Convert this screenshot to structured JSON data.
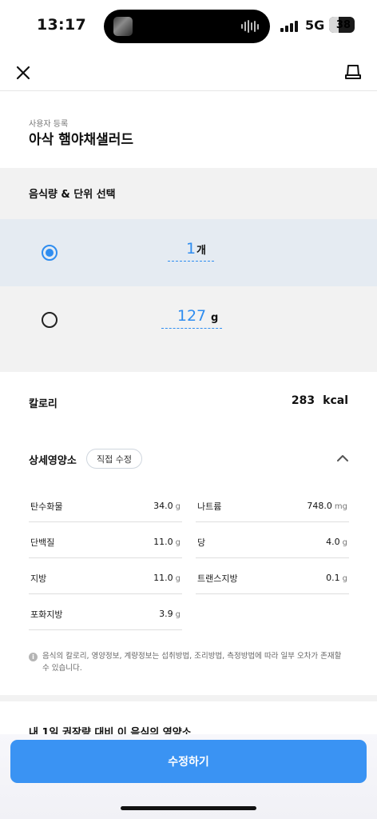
{
  "status": {
    "time": "13:17",
    "network": "5G",
    "battery": "38",
    "battery_level_percent": 38
  },
  "header": {
    "close_icon": "close-icon",
    "save_icon": "save-icon"
  },
  "food": {
    "source": "사용자 등록",
    "name": "아삭 햄야채샐러드"
  },
  "unit_section": {
    "title": "음식량 & 단위 선택",
    "options": [
      {
        "amount": "1",
        "unit": "개",
        "selected": true
      },
      {
        "amount": "127",
        "unit": "g",
        "selected": false
      }
    ]
  },
  "calorie": {
    "label": "칼로리",
    "value": "283",
    "unit": "kcal"
  },
  "detail": {
    "title": "상세영양소",
    "edit_label": "직접 수정",
    "nutrients": [
      {
        "name": "탄수화물",
        "value": "34.0",
        "unit": "g"
      },
      {
        "name": "나트륨",
        "value": "748.0",
        "unit": "mg"
      },
      {
        "name": "단백질",
        "value": "11.0",
        "unit": "g"
      },
      {
        "name": "당",
        "value": "4.0",
        "unit": "g"
      },
      {
        "name": "지방",
        "value": "11.0",
        "unit": "g"
      },
      {
        "name": "트랜스지방",
        "value": "0.1",
        "unit": "g"
      },
      {
        "name": "포화지방",
        "value": "3.9",
        "unit": "g"
      }
    ],
    "notice": "음식의 칼로리, 영양정보, 계량정보는 섭취방법, 조리방법, 측정방법에 따라 일부 오차가 존재할 수 있습니다."
  },
  "next_section": {
    "title": "내 1일 권장량 대비 이 음식의 영양소"
  },
  "footer": {
    "submit_label": "수정하기"
  },
  "colors": {
    "accent": "#3a93f3",
    "selected_row": "#e5ebf2"
  }
}
